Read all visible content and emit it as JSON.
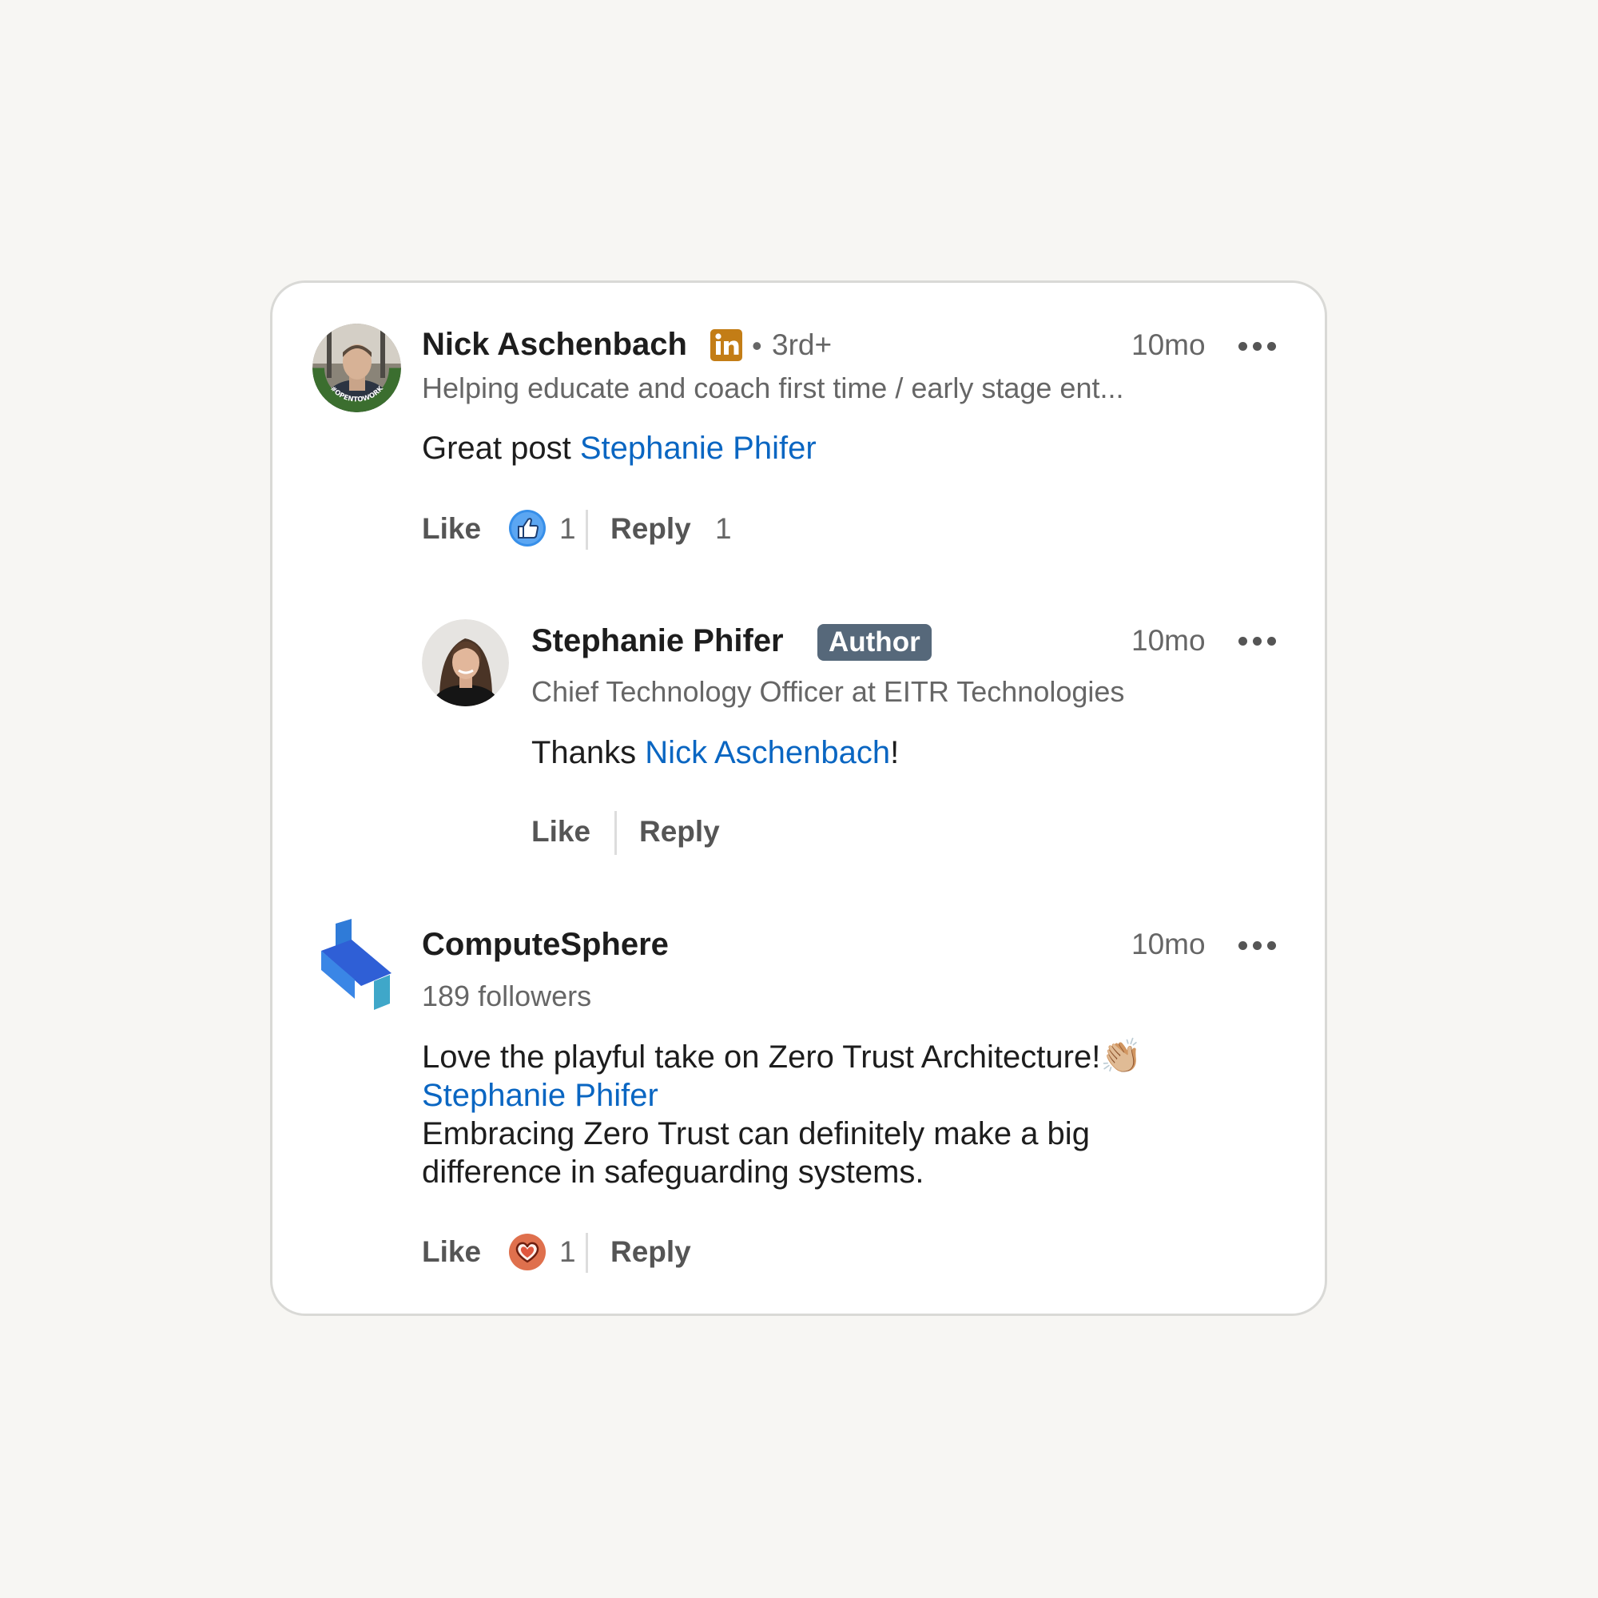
{
  "comments": [
    {
      "author": "Nick Aschenbach",
      "degree": "3rd+",
      "headline": "Helping educate and coach first time / early stage ent...",
      "time": "10mo",
      "text_prefix": "Great post ",
      "mention": "Stephanie Phifer",
      "actions": {
        "like": "Like",
        "like_count": "1",
        "reply": "Reply",
        "reply_count": "1"
      },
      "reaction_icon": "like-thumb-icon",
      "avatar_ring_text": "#OPENTOWORK"
    },
    {
      "author": "Stephanie Phifer",
      "badge": "Author",
      "headline": "Chief Technology Officer at EITR Technologies",
      "time": "10mo",
      "text_prefix": "Thanks ",
      "mention": "Nick Aschenbach",
      "text_suffix": "!",
      "actions": {
        "like": "Like",
        "reply": "Reply"
      }
    },
    {
      "author": "ComputeSphere",
      "headline": "189 followers",
      "time": "10mo",
      "line1": "Love the playful take on Zero Trust Architecture!",
      "emoji": "👏🏼",
      "mention": "Stephanie Phifer",
      "line3": "Embracing Zero Trust can definitely make a big",
      "line4": "difference in safeguarding systems.",
      "actions": {
        "like": "Like",
        "like_count": "1",
        "reply": "Reply"
      },
      "reaction_icon": "love-heart-icon"
    }
  ],
  "colors": {
    "mention": "#0a66c2",
    "author_badge": "#56687a",
    "linkedin_badge": "#c37d16",
    "like_blue": "#378fe9",
    "love_red": "#df704d"
  }
}
